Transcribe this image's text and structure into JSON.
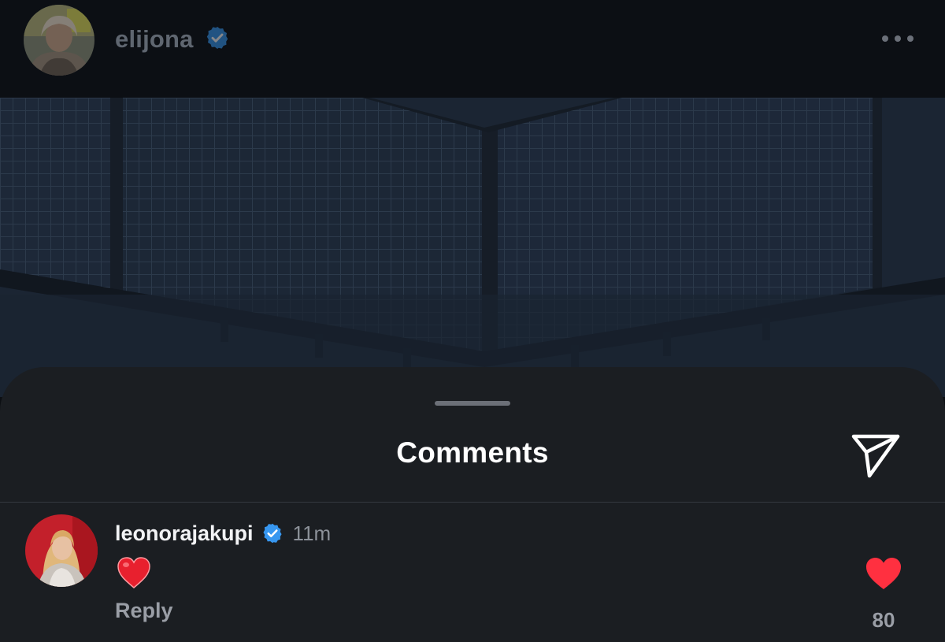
{
  "post": {
    "username": "elijona",
    "verified": true,
    "more_icon": "more-horizontal-icon"
  },
  "comments_sheet": {
    "title": "Comments",
    "share_icon": "paper-plane-icon"
  },
  "comment": {
    "username": "leonorajakupi",
    "verified": true,
    "time": "11m",
    "text": "❤️",
    "reply_label": "Reply",
    "likes": "80",
    "liked": true
  },
  "colors": {
    "sheet_background": "#1b1e22",
    "verified_blue": "#3797f0",
    "like_red": "#ff3040"
  }
}
